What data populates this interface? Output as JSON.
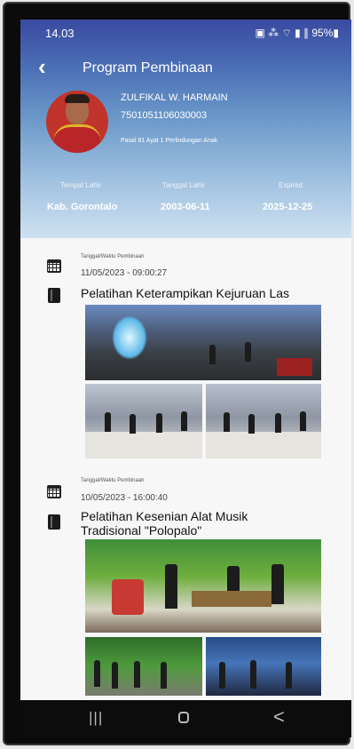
{
  "status_bar": {
    "time": "14.03",
    "indicators": "▣ ⁂ ⌔ ▮ ∥ 95%▮",
    "battery": "95%"
  },
  "header": {
    "back_icon": "back-arrow-icon",
    "title": "Program Pembinaan"
  },
  "profile": {
    "name": "ZULFIKAL W. HARMAIN",
    "id_number": "7501051106030003",
    "pasal": "Pasal 81 Ayat 1 Perlindungan Anak"
  },
  "info": {
    "tempat_lahir_label": "Tempat Lahir",
    "tempat_lahir_value": "Kab. Gorontalo",
    "tanggal_lahir_label": "Tanggal Lahir",
    "tanggal_lahir_value": "2003-06-11",
    "expired_label": "Expired",
    "expired_value": "2025-12-25"
  },
  "activities": [
    {
      "label": "Tanggal/Waktu Pembinaan",
      "datetime": "11/05/2023 - 09:00:27",
      "title": "Pelatihan Keterampikan Kejuruan Las"
    },
    {
      "label": "Tanggal/Waktu Pembinaan",
      "datetime": "10/05/2023 - 16:00:40",
      "title_line1": "Pelatihan Kesenian Alat Musik",
      "title_line2": "Tradisional \"Polopalo\""
    }
  ],
  "nav": {
    "recents": "|||",
    "back": "<"
  },
  "colors": {
    "header_top": "#3a4aa0",
    "header_bottom": "#cfe1f1",
    "navbar": "#0c0c0c"
  }
}
